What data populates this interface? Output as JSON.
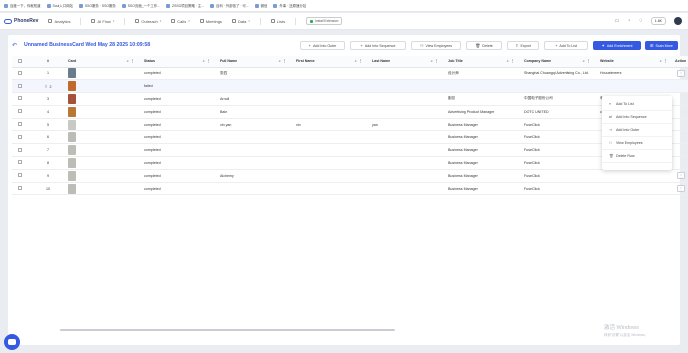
{
  "bookmarks": [
    "百度一下，你就知道",
    "Soul入口网站",
    "SSO服务 · SSO服务",
    "SSO页面_一个工作...",
    "ZSSO项目策略 · 主...",
    "百科 · 外部信了 · 可...",
    "微信",
    "外事 · 还原速分站"
  ],
  "nav": {
    "logo": "PhoneRev",
    "items": [
      {
        "label": "Analytics",
        "chev": ""
      },
      {
        "label": "AI Flow",
        "chev": "▾"
      },
      {
        "label": "Outreach",
        "chev": "▾"
      },
      {
        "label": "Calls",
        "chev": "▾"
      },
      {
        "label": "Meetings",
        "chev": ""
      },
      {
        "label": "Data",
        "chev": "▾"
      },
      {
        "label": "Lists",
        "chev": ""
      }
    ],
    "install": "Install Extension",
    "lang": "1.6K"
  },
  "page": {
    "title": "Unnamed BusinessCard Wed May 28 2025 10:09:58",
    "buttons": {
      "add_outer": "Add Into Outer",
      "add_sequence": "Add Into Sequence",
      "view_employees": "View Employees",
      "delete": "Delete",
      "export": "Export",
      "add_list": "Add To List",
      "add_enrichment": "Add Enrichment",
      "scan_more": "Scan More"
    }
  },
  "table": {
    "headers": {
      "num": "#",
      "card": "Card",
      "status": "Status",
      "full_name": "Full Name",
      "first_name": "First Name",
      "last_name": "Last Name",
      "job_title": "Job Title",
      "company": "Company Name",
      "website": "Website",
      "action": "Action"
    },
    "rows": [
      {
        "num": "1",
        "status": "completed",
        "full_name": "张四",
        "first_name": "",
        "last_name": "",
        "job_title": "设计师",
        "company": "Shanghai Chuangqi Advertising Co., Ltd.",
        "website": "Houueimeers"
      },
      {
        "num": "2",
        "status": "failed",
        "full_name": "",
        "first_name": "",
        "last_name": "",
        "job_title": "",
        "company": "",
        "website": ""
      },
      {
        "num": "3",
        "status": "completed",
        "full_name": "Arnoll",
        "first_name": "",
        "last_name": "",
        "job_title": "副总",
        "company": "中国电子股份公司",
        "website": "电子"
      },
      {
        "num": "4",
        "status": "completed",
        "full_name": "Bain",
        "first_name": "",
        "last_name": "",
        "job_title": "Advertising Product Manager",
        "company": "DOTC UNITED",
        "website": "cdcpc"
      },
      {
        "num": "5",
        "status": "completed",
        "full_name": "xin yan",
        "first_name": "xin",
        "last_name": "yan",
        "job_title": "Business Manager",
        "company": "FuseClick",
        "website": ""
      },
      {
        "num": "6",
        "status": "completed",
        "full_name": "",
        "first_name": "",
        "last_name": "",
        "job_title": "Business Manager",
        "company": "FuseClick",
        "website": ""
      },
      {
        "num": "7",
        "status": "completed",
        "full_name": "",
        "first_name": "",
        "last_name": "",
        "job_title": "Business Manager",
        "company": "FuseClick",
        "website": ""
      },
      {
        "num": "8",
        "status": "completed",
        "full_name": "",
        "first_name": "",
        "last_name": "",
        "job_title": "Business Manager",
        "company": "FuseClick",
        "website": ""
      },
      {
        "num": "9",
        "status": "completed",
        "full_name": "Alchemy",
        "first_name": "",
        "last_name": "",
        "job_title": "Business Manager",
        "company": "FuseClick",
        "website": ""
      },
      {
        "num": "10",
        "status": "completed",
        "full_name": "",
        "first_name": "",
        "last_name": "",
        "job_title": "Business Manager",
        "company": "FuseClick",
        "website": ""
      }
    ]
  },
  "action_menu": [
    "Add To List",
    "Add Into Sequence",
    "Add Into Outer",
    "View Employees",
    "Delete Row"
  ],
  "watermark": {
    "line1": "激活 Windows",
    "line2": "转到\"设置\"以激活 Windows。"
  },
  "colors": {
    "accent": "#3559e0",
    "page_bg": "#e9ecf1"
  }
}
